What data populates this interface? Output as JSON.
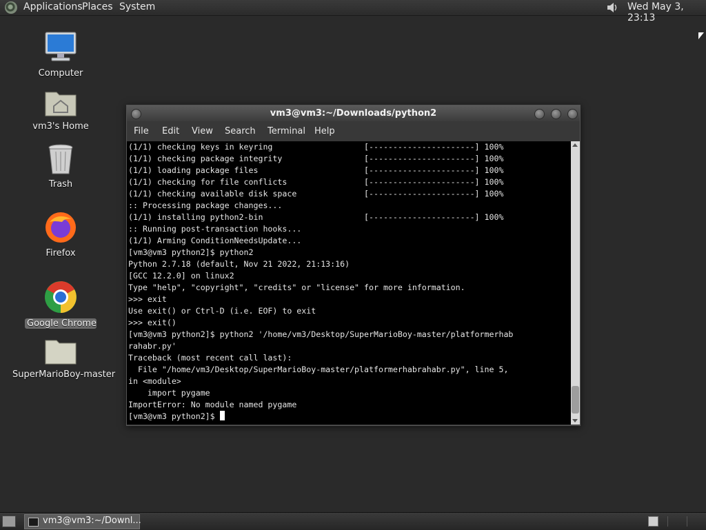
{
  "top_panel": {
    "menus": [
      "Applications",
      "Places",
      "System"
    ],
    "clock": "Wed May  3, 23:13"
  },
  "desktop_icons": [
    {
      "label": "Computer",
      "icon": "computer-icon"
    },
    {
      "label": "vm3's Home",
      "icon": "home-folder-icon"
    },
    {
      "label": "Trash",
      "icon": "trash-icon"
    },
    {
      "label": "Firefox",
      "icon": "firefox-icon"
    },
    {
      "label": "Google Chrome",
      "icon": "chrome-icon",
      "selected": true
    },
    {
      "label": "SuperMarioBoy-master",
      "icon": "folder-icon"
    }
  ],
  "window": {
    "title": "vm3@vm3:~/Downloads/python2",
    "menu": [
      "File",
      "Edit",
      "View",
      "Search",
      "Terminal",
      "Help"
    ]
  },
  "terminal": {
    "lines": [
      "(1/1) checking keys in keyring                   [----------------------] 100%",
      "(1/1) checking package integrity                 [----------------------] 100%",
      "(1/1) loading package files                      [----------------------] 100%",
      "(1/1) checking for file conflicts                [----------------------] 100%",
      "(1/1) checking available disk space              [----------------------] 100%",
      ":: Processing package changes...",
      "(1/1) installing python2-bin                     [----------------------] 100%",
      ":: Running post-transaction hooks...",
      "(1/1) Arming ConditionNeedsUpdate...",
      "[vm3@vm3 python2]$ python2",
      "Python 2.7.18 (default, Nov 21 2022, 21:13:16)",
      "[GCC 12.2.0] on linux2",
      "Type \"help\", \"copyright\", \"credits\" or \"license\" for more information.",
      ">>> exit",
      "Use exit() or Ctrl-D (i.e. EOF) to exit",
      ">>> exit()",
      "[vm3@vm3 python2]$ python2 '/home/vm3/Desktop/SuperMarioBoy-master/platformerhab",
      "rahabr.py'",
      "Traceback (most recent call last):",
      "  File \"/home/vm3/Desktop/SuperMarioBoy-master/platformerhabrahabr.py\", line 5,",
      "in <module>",
      "    import pygame",
      "ImportError: No module named pygame"
    ],
    "prompt": "[vm3@vm3 python2]$ "
  },
  "taskbar": {
    "task_label": "vm3@vm3:~/Downl..."
  }
}
